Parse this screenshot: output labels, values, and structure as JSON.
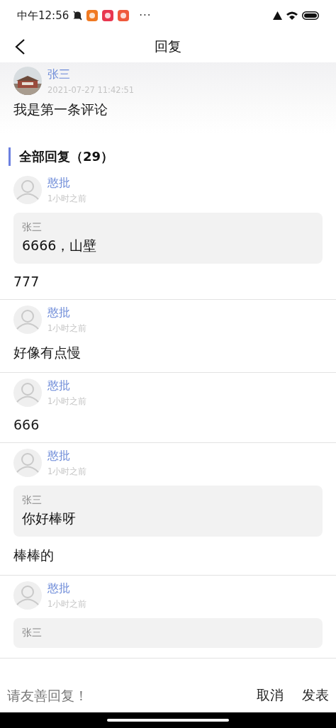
{
  "status_bar": {
    "time": "中午12:56",
    "more": "···"
  },
  "header": {
    "title": "回复"
  },
  "comment": {
    "author": "张三",
    "time": "2021-07-27 11:42:51",
    "text": "我是第一条评论"
  },
  "section": {
    "title": "全部回复（29）"
  },
  "replies": [
    {
      "author": "憨批",
      "time": "1小时之前",
      "quote": {
        "author": "张三",
        "text": "6666，山壁"
      },
      "text": "777"
    },
    {
      "author": "憨批",
      "time": "1小时之前",
      "text": "好像有点慢"
    },
    {
      "author": "憨批",
      "time": "1小时之前",
      "text": "666"
    },
    {
      "author": "憨批",
      "time": "1小时之前",
      "quote": {
        "author": "张三",
        "text": "你好棒呀"
      },
      "text": "棒棒的"
    },
    {
      "author": "憨批",
      "time": "1小时之前",
      "quote": {
        "author": "张三"
      }
    }
  ],
  "composer": {
    "placeholder": "请友善回复！",
    "buttons": [
      "取消",
      "发表"
    ]
  }
}
